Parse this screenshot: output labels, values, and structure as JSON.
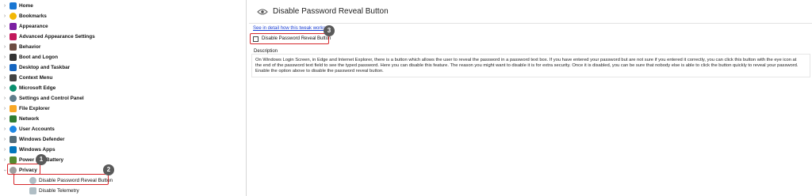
{
  "tree": {
    "items": [
      {
        "label": "Home",
        "color": "#1976d2"
      },
      {
        "label": "Bookmarks",
        "color": "#f2b705"
      },
      {
        "label": "Appearance",
        "color": "#7b1fa2"
      },
      {
        "label": "Advanced Appearance Settings",
        "color": "#c2185b"
      },
      {
        "label": "Behavior",
        "color": "#6d4c41"
      },
      {
        "label": "Boot and Logon",
        "color": "#333333"
      },
      {
        "label": "Desktop and Taskbar",
        "color": "#1565c0"
      },
      {
        "label": "Context Menu",
        "color": "#424242"
      },
      {
        "label": "Microsoft Edge",
        "color": "#0a8f6e"
      },
      {
        "label": "Settings and Control Panel",
        "color": "#607d8b"
      },
      {
        "label": "File Explorer",
        "color": "#f9a825"
      },
      {
        "label": "Network",
        "color": "#2e7d32"
      },
      {
        "label": "User Accounts",
        "color": "#1e88e5"
      },
      {
        "label": "Windows Defender",
        "color": "#546e7a"
      },
      {
        "label": "Windows Apps",
        "color": "#0277bd"
      },
      {
        "label": "Power and Battery",
        "color": "#558b2f"
      },
      {
        "label": "Privacy",
        "color": "#9e9e9e"
      }
    ],
    "children": [
      {
        "label": "Disable Password Reveal Button"
      },
      {
        "label": "Disable Telemetry"
      }
    ]
  },
  "details": {
    "title": "Disable Password Reveal Button",
    "link_text": "See in detail how this tweak works",
    "checkbox_label": "Disable Password Reveal Button",
    "checkbox_checked": false,
    "description_label": "Description",
    "description_text": "On Windows Login Screen, in Edge and Internet Explorer, there is a button which allows the user to reveal the password in a password text box. If you have entered your password but are not sure if you entered it correctly, you can click this button with the eye icon at the end of the password text field to see the typed password. Here you can disable this feature. The reason you might want to disable it is for extra security. Once it is disabled, you can be sure that nobody else is able to click the button quickly to reveal your password. Enable the option above to disable the password reveal button."
  },
  "annotations": {
    "badge1": "1",
    "badge2": "2",
    "badge3": "3",
    "highlight_color": "#d6272b"
  }
}
